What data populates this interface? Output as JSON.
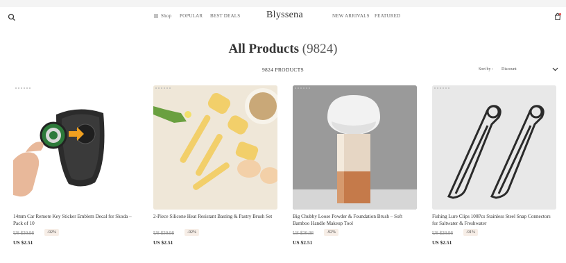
{
  "header": {
    "brand": "Blyssena",
    "nav_left": [
      {
        "label": "Shop"
      },
      {
        "label": "POPULAR"
      },
      {
        "label": "BEST DEALS"
      }
    ],
    "nav_right": [
      {
        "label": "NEW ARRIVALS"
      },
      {
        "label": "FEATURED"
      }
    ],
    "icons": {
      "search": "search-icon",
      "cart": "cart-icon",
      "menu": "hamburger-icon"
    }
  },
  "page": {
    "title": "All Products",
    "count": "(9824)",
    "product_count_label": "9824 PRODUCTS",
    "sort_label": "Sort by :",
    "sort_value": "Discount"
  },
  "products": [
    {
      "name": "14mm Car Remote Key Sticker Emblem Decal for Skoda – Pack of 10",
      "old_price": "US $30.98",
      "discount": "-92%",
      "price": "US $2.51"
    },
    {
      "name": "2-Piece Silicone Heat Resistant Basting & Pastry Brush Set",
      "old_price": "US $30.98",
      "discount": "-92%",
      "price": "US $2.51"
    },
    {
      "name": "Big Chubby Loose Powder & Foundation Brush – Soft Bamboo Handle Makeup Tool",
      "old_price": "US $30.98",
      "discount": "-92%",
      "price": "US $2.51"
    },
    {
      "name": "Fishing Lure Clips 100Pcs Stainless Steel Snap Connectors for Saltwater & Freshwater",
      "old_price": "US $28.98",
      "discount": "-91%",
      "price": "US $2.51"
    }
  ],
  "colors": {
    "badge_bg": "#f7eee7",
    "text": "#333333"
  }
}
